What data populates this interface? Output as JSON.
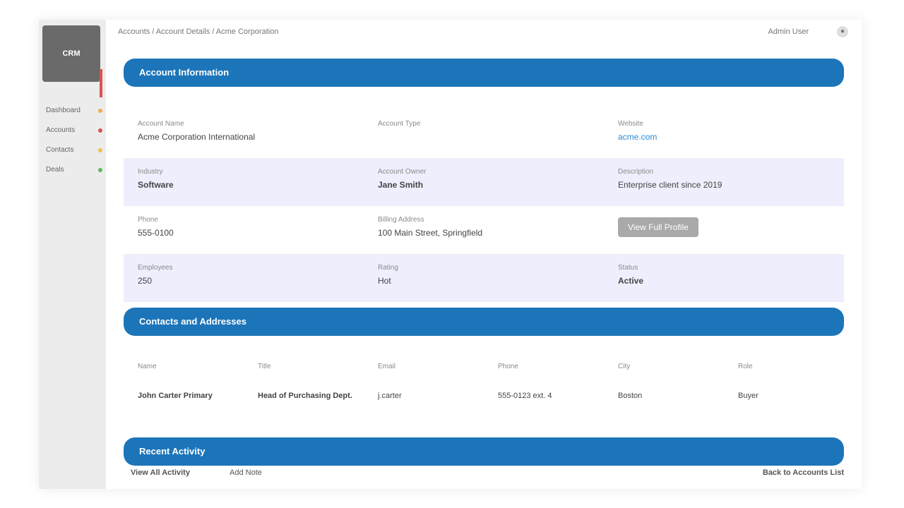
{
  "app": {
    "logo_text": "CRM",
    "breadcrumb": "Accounts / Account Details / Acme Corporation",
    "top_right_text": "Admin User",
    "top_icon": "user-icon"
  },
  "sidebar": {
    "items": [
      {
        "label": "Dashboard",
        "dot_color": "#f0ad4e"
      },
      {
        "label": "Accounts",
        "dot_color": "#d9534f"
      },
      {
        "label": "Contacts",
        "dot_color": "#f0c04e"
      },
      {
        "label": "Deals",
        "dot_color": "#5cb85c"
      }
    ],
    "accent_color": "#d9534f"
  },
  "sections": {
    "account_info": "Account Information",
    "contacts": "Contacts and Addresses",
    "activity": "Recent Activity"
  },
  "info": {
    "rows": [
      [
        {
          "label": "Account Name",
          "value": "Acme Corporation International",
          "style": ""
        },
        {
          "label": "Account Type",
          "value": "",
          "style": ""
        },
        {
          "label": "Website",
          "value": "acme.com",
          "style": "link"
        }
      ],
      [
        {
          "label": "Industry",
          "value": "Software",
          "style": "bold"
        },
        {
          "label": "Account Owner",
          "value": "Jane Smith",
          "style": "bold"
        },
        {
          "label": "Description",
          "value": "Enterprise client since 2019",
          "style": ""
        }
      ],
      [
        {
          "label": "Phone",
          "value": "555-0100",
          "style": ""
        },
        {
          "label": "Billing Address",
          "value": "100 Main Street, Springfield",
          "style": ""
        },
        {
          "label": "",
          "value": "View Full Profile",
          "style": "button"
        }
      ],
      [
        {
          "label": "Employees",
          "value": "250",
          "style": ""
        },
        {
          "label": "Rating",
          "value": "Hot",
          "style": ""
        },
        {
          "label": "Status",
          "value": "Active",
          "style": "bold"
        }
      ]
    ]
  },
  "contacts_table": {
    "headers": [
      "Name",
      "Title",
      "Email",
      "Phone",
      "City",
      "Role"
    ],
    "rows": [
      [
        "John Carter Primary",
        "Head of Purchasing Dept.",
        "j.carter",
        "555-0123 ext. 4",
        "Boston",
        "Buyer"
      ]
    ]
  },
  "footer": {
    "left_link": "View All Activity",
    "left_link2": "Add Note",
    "right_link": "Back to Accounts List"
  }
}
